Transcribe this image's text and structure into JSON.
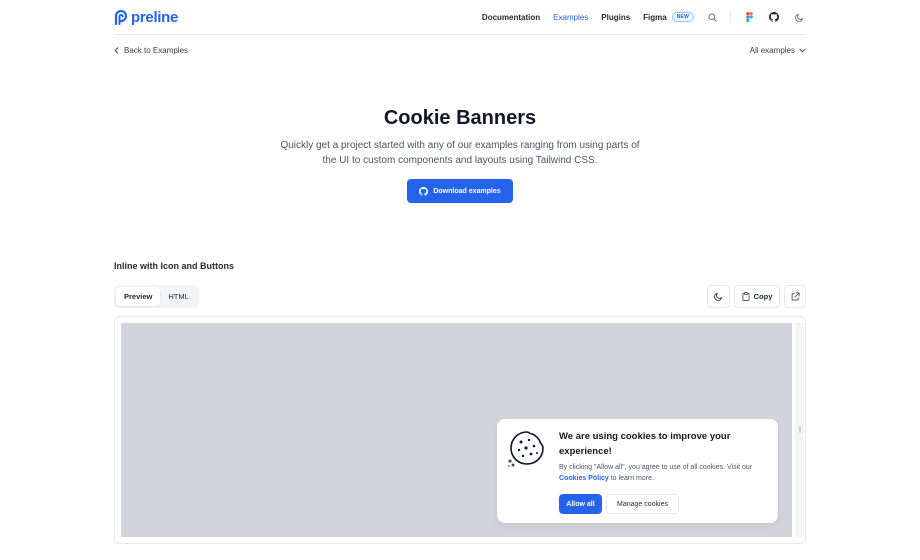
{
  "header": {
    "brand": "preline",
    "nav": {
      "documentation": "Documentation",
      "examples": "Examples",
      "plugins": "Plugins",
      "figma": "Figma",
      "figma_badge": "NEW"
    },
    "icons": [
      "search-icon",
      "figma-icon",
      "github-icon",
      "moon-icon"
    ]
  },
  "subbar": {
    "back_label": "Back to Examples",
    "all_examples_label": "All examples"
  },
  "hero": {
    "title": "Cookie Banners",
    "description": "Quickly get a project started with any of our examples ranging from using parts of the UI to custom components and layouts using Tailwind CSS.",
    "download_label": "Download examples"
  },
  "section": {
    "title": "Inline with Icon and Buttons",
    "tabs": [
      {
        "label": "Preview",
        "selected": true
      },
      {
        "label": "HTML",
        "selected": false
      }
    ],
    "copy_label": "Copy"
  },
  "cookie": {
    "title": "We are using cookies to improve your experience!",
    "text_before": "By clicking \"Allow all\", you agree to use of all cookies. Visit our ",
    "policy_link": "Cookies Policy",
    "text_after": " to learn more.",
    "allow_label": "Allow all",
    "manage_label": "Manage cookies"
  },
  "colors": {
    "accent": "#2563eb",
    "preview_background": "#d1d5db"
  }
}
